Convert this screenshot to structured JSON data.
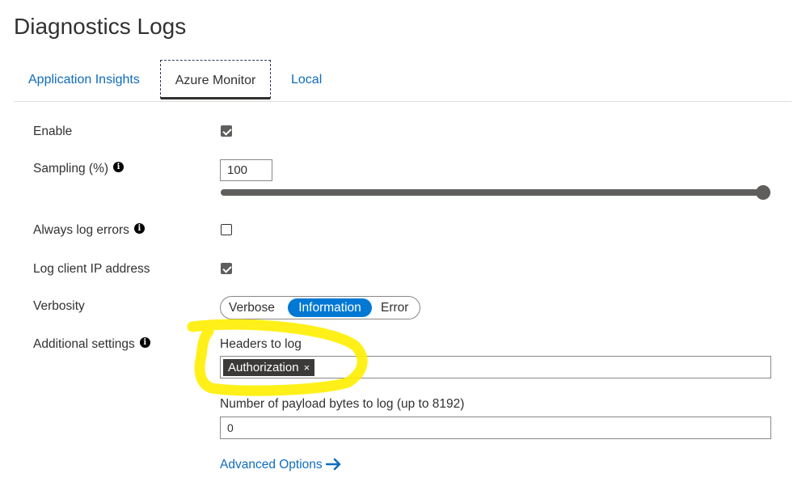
{
  "page": {
    "title": "Diagnostics Logs"
  },
  "tabs": [
    {
      "label": "Application Insights",
      "active": false
    },
    {
      "label": "Azure Monitor",
      "active": true
    },
    {
      "label": "Local",
      "active": false
    }
  ],
  "form": {
    "enable": {
      "label": "Enable",
      "checked": true
    },
    "sampling": {
      "label": "Sampling (%)",
      "value": "100",
      "slider_percent": 100
    },
    "always_log_errors": {
      "label": "Always log errors",
      "checked": false
    },
    "log_client_ip": {
      "label": "Log client IP address",
      "checked": true
    },
    "verbosity": {
      "label": "Verbosity",
      "options": [
        "Verbose",
        "Information",
        "Error"
      ],
      "selected": "Information"
    },
    "additional_settings": {
      "label": "Additional settings",
      "headers_label": "Headers to log",
      "headers": [
        "Authorization"
      ],
      "tag_remove_glyph": "×",
      "payload_label": "Number of payload bytes to log (up to 8192)",
      "payload_value": "0"
    },
    "advanced_link": "Advanced Options"
  },
  "colors": {
    "accent": "#0078d4",
    "link": "#0f6cbd",
    "highlight": "#ffee00"
  },
  "icons": {
    "info": "info-icon",
    "advanced": "arrow-right-icon"
  }
}
